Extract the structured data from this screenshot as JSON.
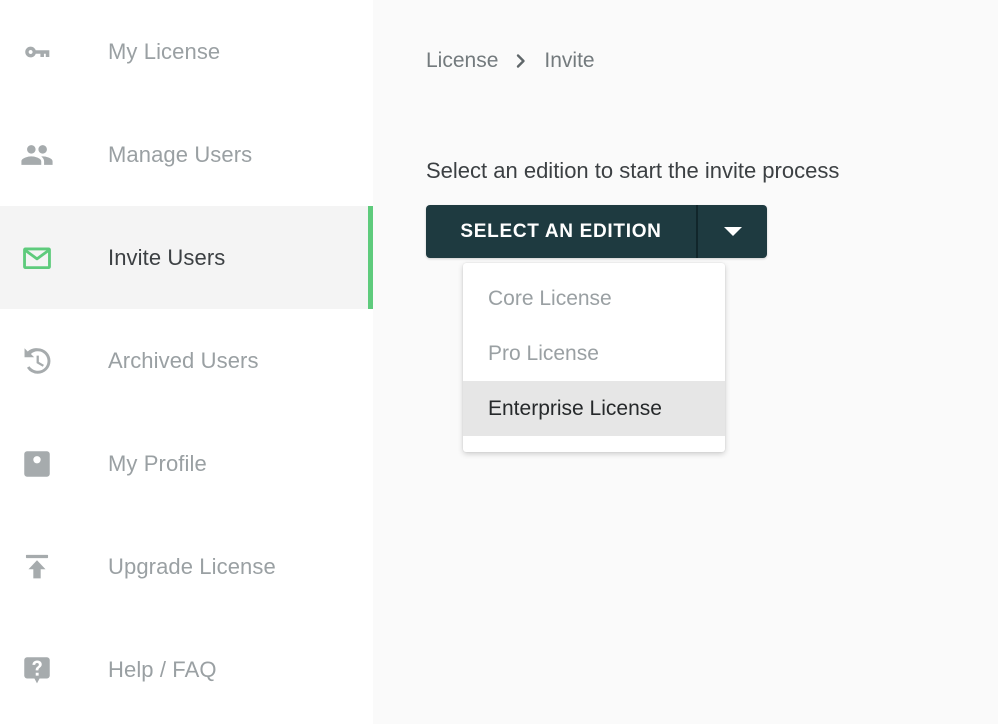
{
  "sidebar": {
    "items": [
      {
        "label": "My License",
        "icon": "key-icon",
        "active": false,
        "name": "sidebar-item-my-license"
      },
      {
        "label": "Manage Users",
        "icon": "people-icon",
        "active": false,
        "name": "sidebar-item-manage-users"
      },
      {
        "label": "Invite Users",
        "icon": "envelope-icon",
        "active": true,
        "name": "sidebar-item-invite-users"
      },
      {
        "label": "Archived Users",
        "icon": "history-icon",
        "active": false,
        "name": "sidebar-item-archived-users"
      },
      {
        "label": "My Profile",
        "icon": "account-box-icon",
        "active": false,
        "name": "sidebar-item-my-profile"
      },
      {
        "label": "Upgrade License",
        "icon": "upload-icon",
        "active": false,
        "name": "sidebar-item-upgrade-license"
      },
      {
        "label": "Help / FAQ",
        "icon": "help-bubble-icon",
        "active": false,
        "name": "sidebar-item-help-faq"
      }
    ]
  },
  "breadcrumb": {
    "parent": "License",
    "separator_icon": "chevron-right-icon",
    "current": "Invite"
  },
  "main": {
    "heading": "Select an edition to start the invite process",
    "select_button": {
      "label": "SELECT AN EDITION",
      "toggle_icon": "caret-down-icon"
    },
    "dropdown": {
      "open": true,
      "options": [
        {
          "label": "Core License",
          "highlighted": false
        },
        {
          "label": "Pro License",
          "highlighted": false
        },
        {
          "label": "Enterprise License",
          "highlighted": true
        }
      ]
    }
  },
  "colors": {
    "accent_green": "#5ecb7c",
    "button_dark": "#1e3a40",
    "sidebar_bg": "#ffffff",
    "active_item_bg": "#f4f4f4",
    "main_bg": "#fafafa",
    "muted_text": "#9aa0a3",
    "primary_text": "#3c4043",
    "highlight_bg": "#e6e6e6"
  }
}
